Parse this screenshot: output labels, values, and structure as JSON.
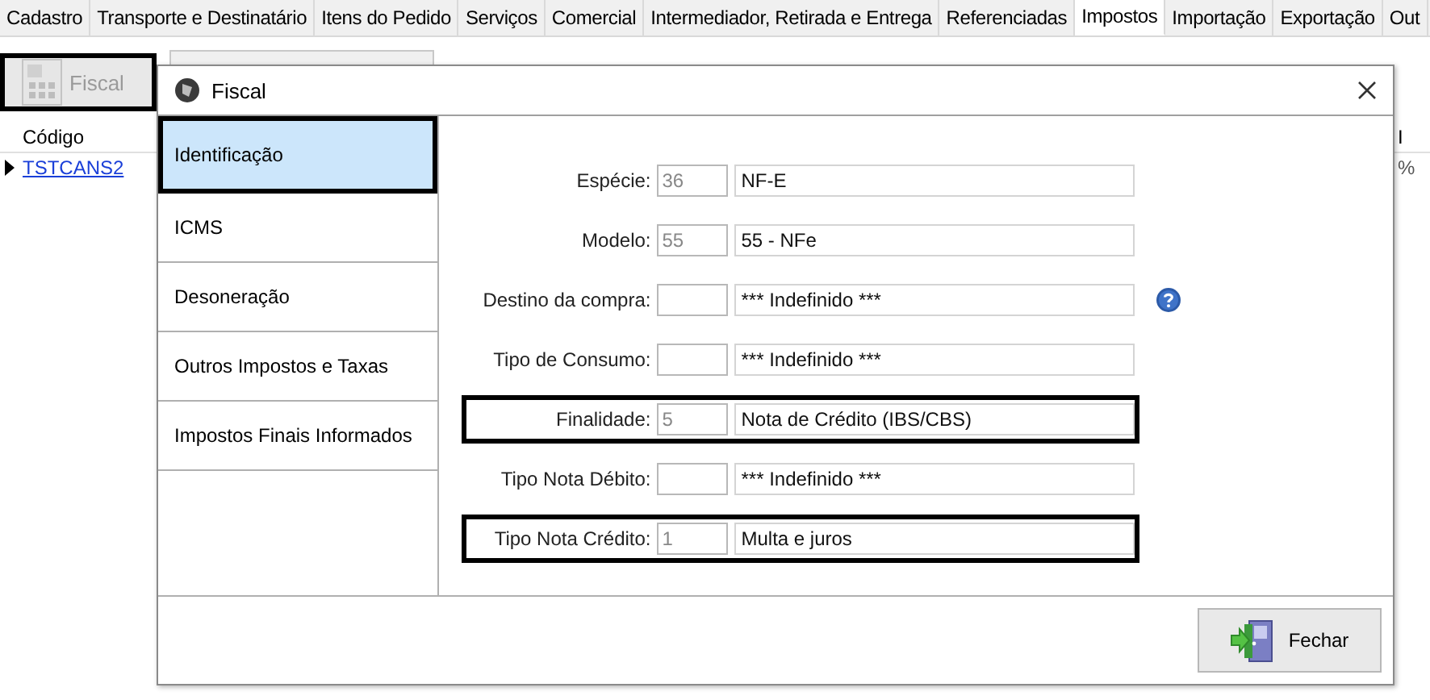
{
  "tabs": [
    {
      "label": "Cadastro",
      "selected": false
    },
    {
      "label": "Transporte e Destinatário",
      "selected": false
    },
    {
      "label": "Itens do Pedido",
      "selected": false
    },
    {
      "label": "Serviços",
      "selected": false
    },
    {
      "label": "Comercial",
      "selected": false
    },
    {
      "label": "Intermediador, Retirada e Entrega",
      "selected": false
    },
    {
      "label": "Referenciadas",
      "selected": false
    },
    {
      "label": "Impostos",
      "selected": true
    },
    {
      "label": "Importação",
      "selected": false
    },
    {
      "label": "Exportação",
      "selected": false
    },
    {
      "label": "Out",
      "selected": false
    }
  ],
  "toolbar": {
    "fiscal_button": {
      "label": "Fiscal",
      "highlighted": true,
      "disabled": true
    }
  },
  "grid": {
    "columns": [
      "Código",
      "I"
    ],
    "rows": [
      {
        "cells": [
          "TSTCANS2",
          "%"
        ],
        "selected": true
      }
    ]
  },
  "dialog": {
    "title": "Fiscal",
    "nav_items": [
      {
        "label": "Identificação",
        "selected": true,
        "highlighted": true
      },
      {
        "label": "ICMS",
        "selected": false,
        "highlighted": false
      },
      {
        "label": "Desoneração",
        "selected": false,
        "highlighted": false
      },
      {
        "label": "Outros Impostos e Taxas",
        "selected": false,
        "highlighted": false
      },
      {
        "label": "Impostos Finais Informados",
        "selected": false,
        "highlighted": false
      }
    ],
    "fields": [
      {
        "label": "Espécie:",
        "code": "36",
        "description": "NF-E",
        "highlighted": false,
        "help": false
      },
      {
        "label": "Modelo:",
        "code": "55",
        "description": "55 - NFe",
        "highlighted": false,
        "help": false
      },
      {
        "label": "Destino da compra:",
        "description": "*** Indefinido ***",
        "highlighted": false,
        "help": true
      },
      {
        "label": "Tipo de Consumo:",
        "description": "*** Indefinido ***",
        "highlighted": false,
        "help": false
      },
      {
        "label": "Finalidade:",
        "code": "5",
        "description": "Nota de Crédito (IBS/CBS)",
        "highlighted": true,
        "help": false
      },
      {
        "label": "Tipo Nota Débito:",
        "description": "*** Indefinido ***",
        "highlighted": false,
        "help": false
      },
      {
        "label": "Tipo Nota Crédito:",
        "code": "1",
        "description": "Multa e juros",
        "highlighted": true,
        "help": false
      }
    ],
    "close_button": {
      "label": "Fechar"
    }
  }
}
